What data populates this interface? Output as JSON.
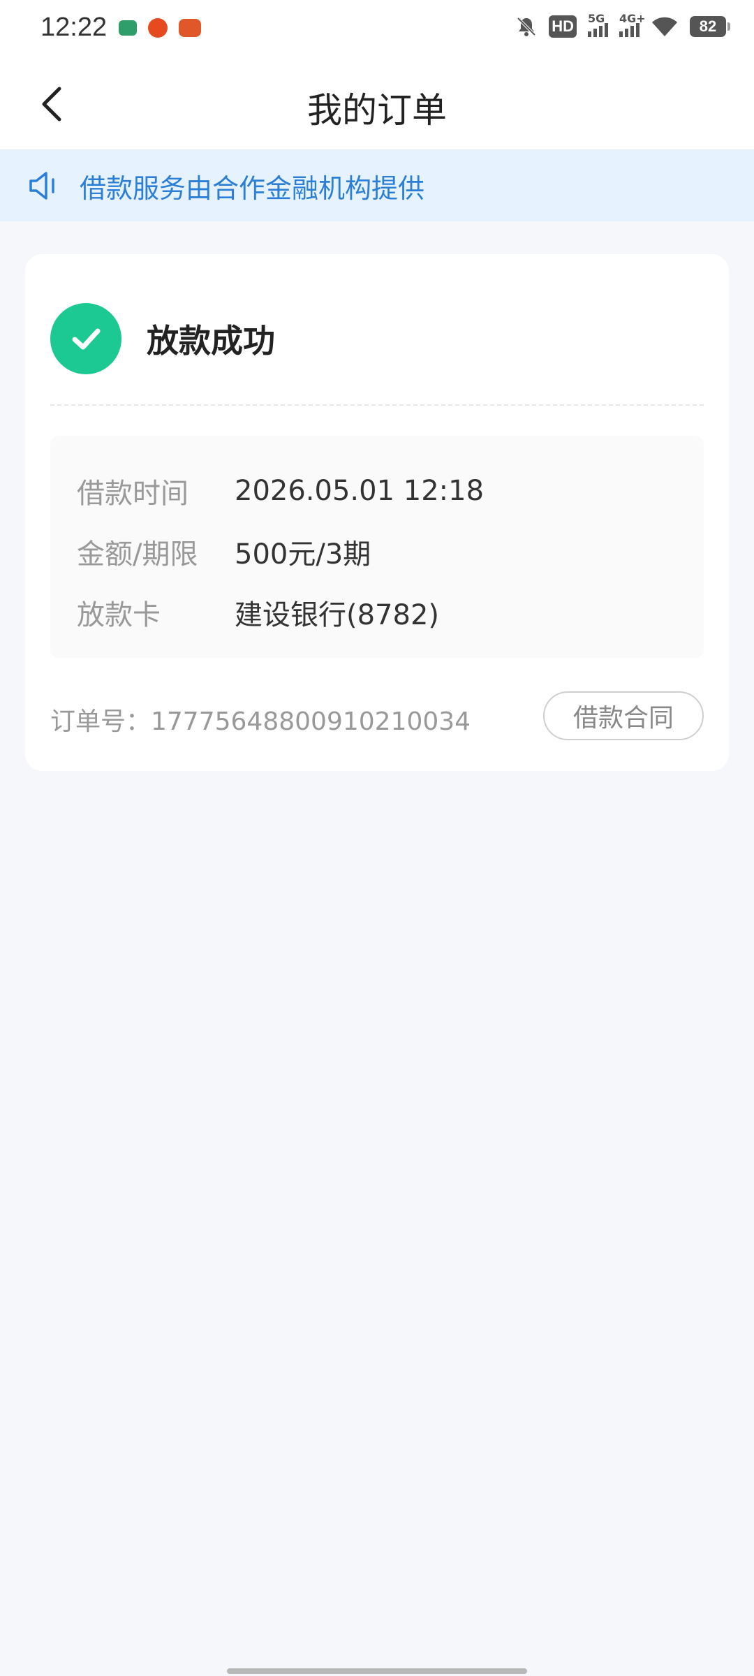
{
  "status_bar": {
    "time": "12:22",
    "hd_label": "HD",
    "network_1": "5G",
    "network_2": "4G+",
    "battery": "82"
  },
  "nav": {
    "title": "我的订单"
  },
  "notice": {
    "text": "借款服务由合作金融机构提供"
  },
  "order": {
    "status_title": "放款成功",
    "info": [
      {
        "label": "借款时间",
        "value": "2026.05.01 12:18"
      },
      {
        "label": "金额/期限",
        "value": "500元/3期"
      },
      {
        "label": "放款卡",
        "value": "建设银行(8782)"
      }
    ],
    "order_number_text": "订单号：1777564880091021003​4",
    "contract_button_label": "借款合同"
  },
  "colors": {
    "accent_blue": "#2b7fd6",
    "banner_bg": "#e7f2ff",
    "success_green": "#1cc993",
    "page_bg": "#f5f7fa"
  },
  "icons": [
    "back-arrow-icon",
    "speaker-icon",
    "checkmark-icon",
    "mute-bell-icon",
    "wifi-icon",
    "battery-icon"
  ]
}
